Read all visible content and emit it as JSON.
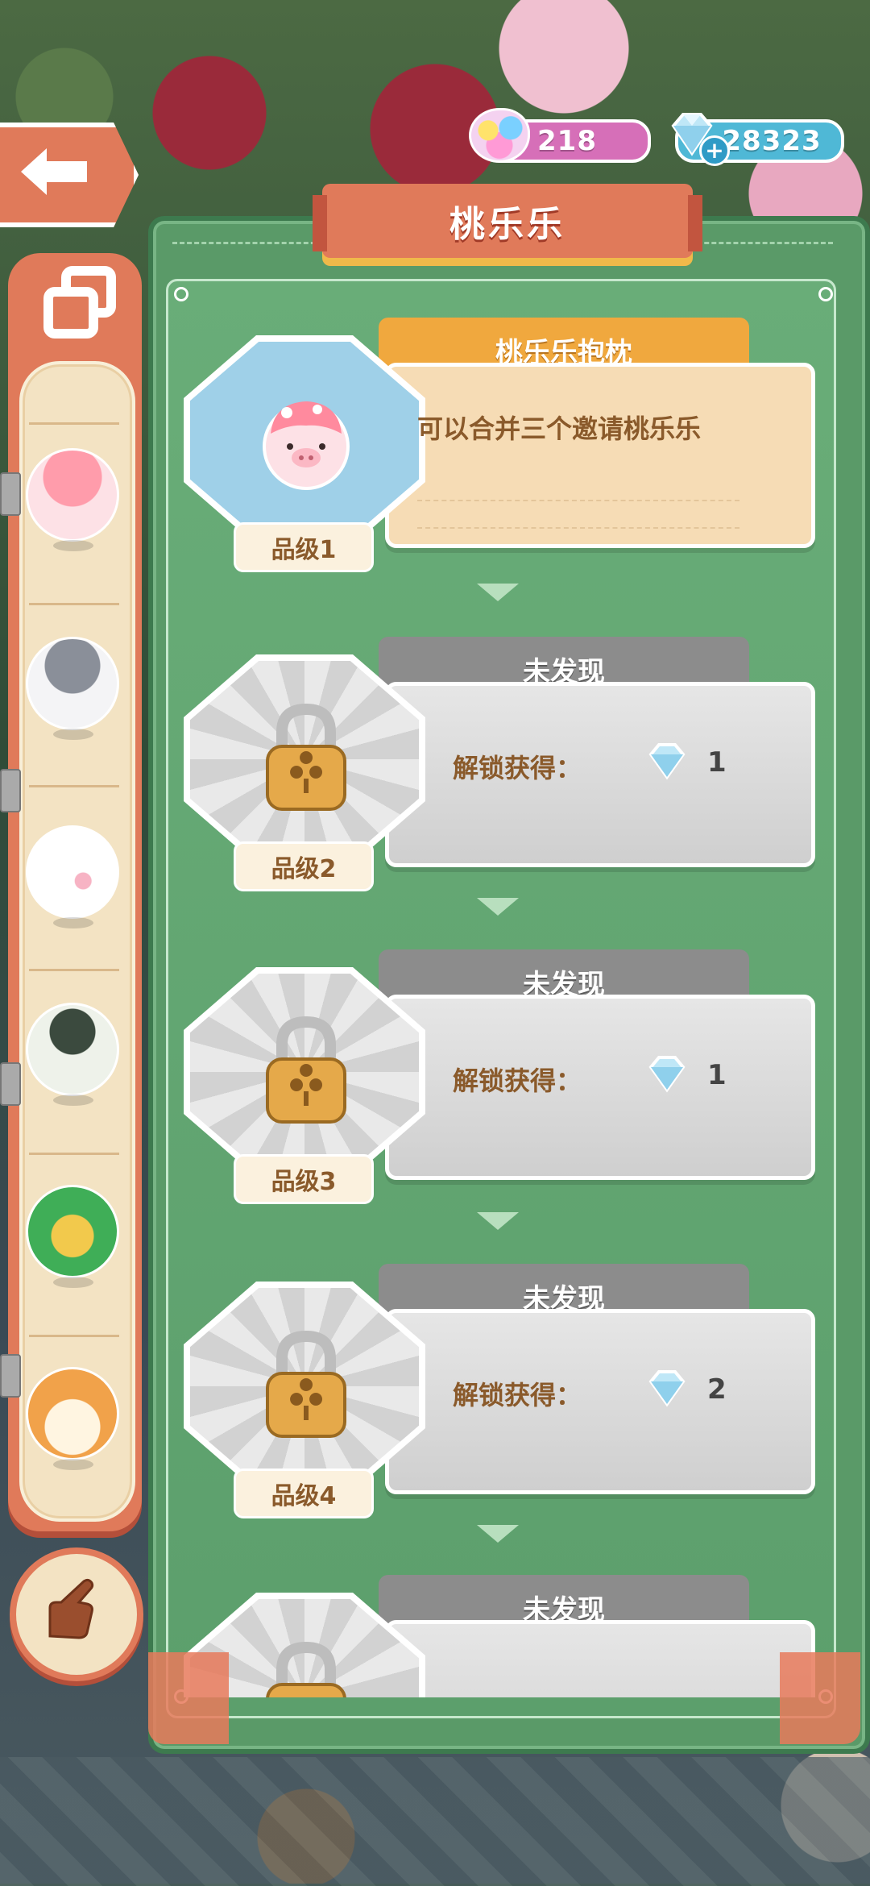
{
  "currency": {
    "cotton_candy": "218",
    "gems": "28323"
  },
  "panel": {
    "title": "桃乐乐"
  },
  "cards": [
    {
      "state": "unlocked",
      "tab": "桃乐乐抱枕",
      "description": "可以合并三个邀请桃乐乐",
      "grade": "品级1"
    },
    {
      "state": "locked",
      "tab": "未发现",
      "unlock_label": "解锁获得：",
      "reward": "1",
      "grade": "品级2"
    },
    {
      "state": "locked",
      "tab": "未发现",
      "unlock_label": "解锁获得：",
      "reward": "1",
      "grade": "品级3"
    },
    {
      "state": "locked",
      "tab": "未发现",
      "unlock_label": "解锁获得：",
      "reward": "2",
      "grade": "品级4"
    },
    {
      "state": "locked",
      "tab": "未发现"
    }
  ],
  "sidebar": {
    "items": [
      {
        "icon": "pink-pig-icon"
      },
      {
        "icon": "gray-cat-icon"
      },
      {
        "icon": "white-bird-icon"
      },
      {
        "icon": "badger-icon"
      },
      {
        "icon": "green-parrot-icon"
      },
      {
        "icon": "shiba-dog-icon"
      }
    ]
  },
  "colors": {
    "accent_orange": "#e07a5a",
    "panel_green": "#5a9a68",
    "tab_gold": "#f0a83e",
    "locked_gray": "#8c8c8c"
  }
}
